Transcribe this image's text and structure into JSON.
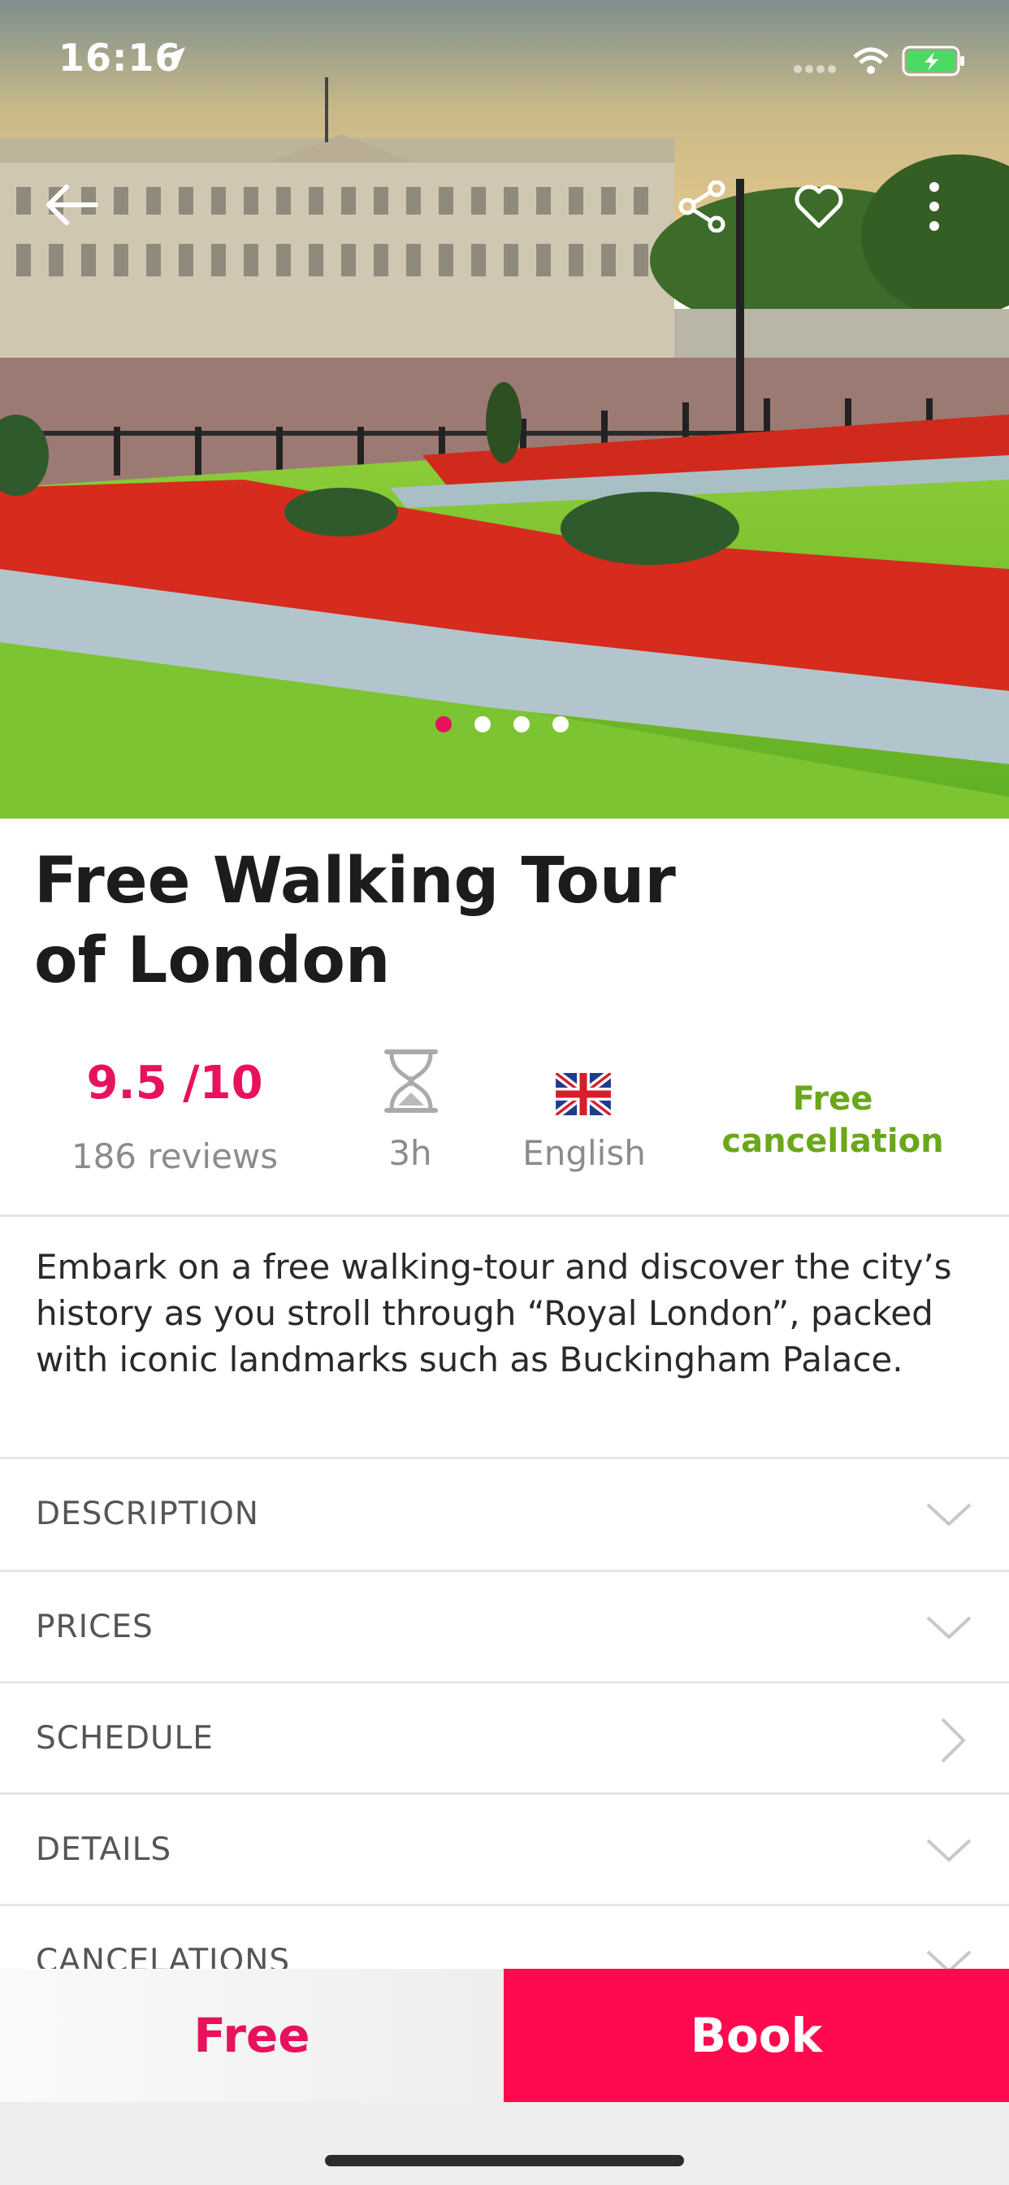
{
  "status_bar": {
    "time": "16:16"
  },
  "hero": {
    "image_subject": "Buckingham Palace with flower beds",
    "carousel": {
      "total": 4,
      "active_index": 0
    },
    "icons": [
      "back-arrow-icon",
      "share-icon",
      "heart-icon",
      "more-vertical-icon"
    ]
  },
  "tour": {
    "title_line1": "Free Walking Tour",
    "title_line2": "of London",
    "rating": "9.5 /10",
    "reviews": "186 reviews",
    "duration": "3h",
    "language": "English",
    "cancellation_line1": "Free",
    "cancellation_line2": "cancellation",
    "summary": "Embark on a free walking-tour and discover the city’s history as you stroll through “Royal London”, packed with iconic landmarks such as Buckingham Palace."
  },
  "sections": [
    {
      "label": "DESCRIPTION",
      "chevron": "chevron-down-icon"
    },
    {
      "label": "PRICES",
      "chevron": "chevron-down-icon"
    },
    {
      "label": "SCHEDULE",
      "chevron": "chevron-right-icon"
    },
    {
      "label": "DETAILS",
      "chevron": "chevron-down-icon"
    },
    {
      "label": "CANCELATIONS",
      "chevron": "chevron-down-icon"
    }
  ],
  "bottom_bar": {
    "price": "Free",
    "book_label": "Book"
  },
  "colors": {
    "accent_pink": "#e8115d",
    "book_button": "#ff0a4e",
    "cancellation_green": "#6aa71a",
    "muted_text": "#8c8c8c"
  }
}
